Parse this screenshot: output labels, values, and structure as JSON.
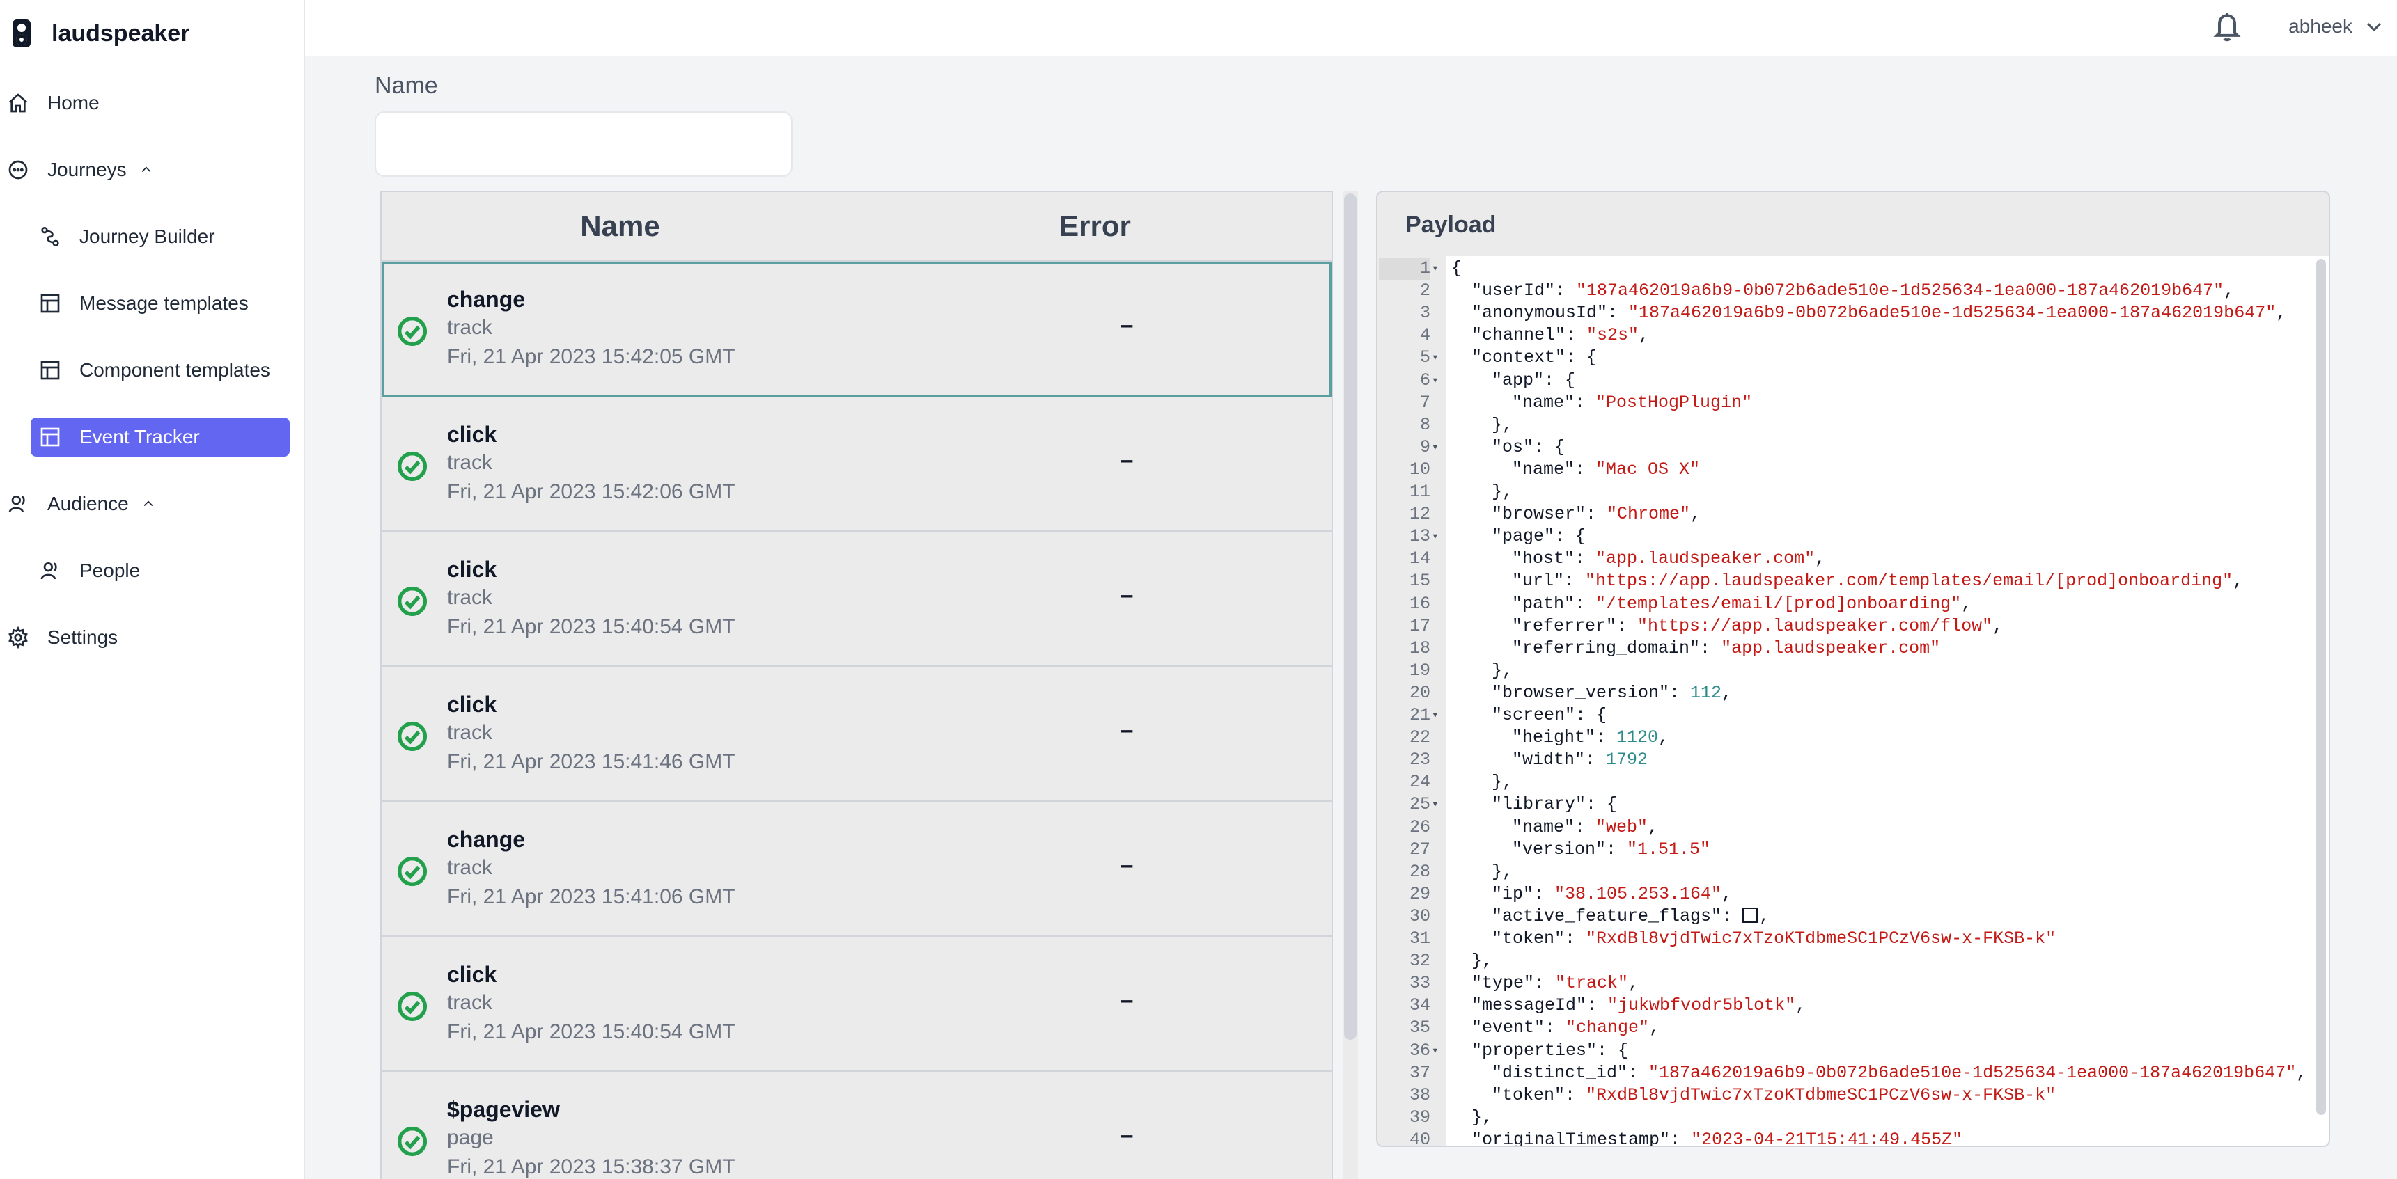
{
  "app": {
    "brand": "laudspeaker"
  },
  "sidebar": {
    "items": [
      {
        "label": "Home",
        "icon": "home-icon"
      },
      {
        "label": "Journeys",
        "icon": "journeys-icon"
      },
      {
        "label": "Journey Builder",
        "icon": "journey-builder-icon"
      },
      {
        "label": "Message templates",
        "icon": "template-icon"
      },
      {
        "label": "Component templates",
        "icon": "template-icon"
      },
      {
        "label": "Event Tracker",
        "icon": "template-icon"
      },
      {
        "label": "Audience",
        "icon": "audience-icon"
      },
      {
        "label": "People",
        "icon": "people-icon"
      },
      {
        "label": "Settings",
        "icon": "gear-icon"
      }
    ],
    "active": "Event Tracker"
  },
  "header": {
    "user": "abheek"
  },
  "filter": {
    "label": "Name",
    "value": ""
  },
  "table": {
    "headers": {
      "name": "Name",
      "error": "Error"
    },
    "rows": [
      {
        "name": "change",
        "type": "track",
        "time": "Fri, 21 Apr 2023 15:42:05 GMT",
        "error": "–"
      },
      {
        "name": "click",
        "type": "track",
        "time": "Fri, 21 Apr 2023 15:42:06 GMT",
        "error": "–"
      },
      {
        "name": "click",
        "type": "track",
        "time": "Fri, 21 Apr 2023 15:40:54 GMT",
        "error": "–"
      },
      {
        "name": "click",
        "type": "track",
        "time": "Fri, 21 Apr 2023 15:41:46 GMT",
        "error": "–"
      },
      {
        "name": "change",
        "type": "track",
        "time": "Fri, 21 Apr 2023 15:41:06 GMT",
        "error": "–"
      },
      {
        "name": "click",
        "type": "track",
        "time": "Fri, 21 Apr 2023 15:40:54 GMT",
        "error": "–"
      },
      {
        "name": "$pageview",
        "type": "page",
        "time": "Fri, 21 Apr 2023 15:38:37 GMT",
        "error": "–"
      }
    ]
  },
  "payload": {
    "title": "Payload",
    "lines": [
      {
        "n": "1",
        "fold": true,
        "indent": 0,
        "parts": [
          [
            "p",
            "{"
          ]
        ]
      },
      {
        "n": "2",
        "indent": 1,
        "parts": [
          [
            "p",
            "\"userId\": "
          ],
          [
            "s",
            "\"187a462019a6b9-0b072b6ade510e-1d525634-1ea000-187a462019b647\""
          ],
          [
            "p",
            ","
          ]
        ]
      },
      {
        "n": "3",
        "indent": 1,
        "parts": [
          [
            "p",
            "\"anonymousId\": "
          ],
          [
            "s",
            "\"187a462019a6b9-0b072b6ade510e-1d525634-1ea000-187a462019b647\""
          ],
          [
            "p",
            ","
          ]
        ]
      },
      {
        "n": "4",
        "indent": 1,
        "parts": [
          [
            "p",
            "\"channel\": "
          ],
          [
            "s",
            "\"s2s\""
          ],
          [
            "p",
            ","
          ]
        ]
      },
      {
        "n": "5",
        "fold": true,
        "indent": 1,
        "parts": [
          [
            "p",
            "\"context\": {"
          ]
        ]
      },
      {
        "n": "6",
        "fold": true,
        "indent": 2,
        "parts": [
          [
            "p",
            "\"app\": {"
          ]
        ]
      },
      {
        "n": "7",
        "indent": 3,
        "parts": [
          [
            "p",
            "\"name\": "
          ],
          [
            "s",
            "\"PostHogPlugin\""
          ]
        ]
      },
      {
        "n": "8",
        "indent": 2,
        "parts": [
          [
            "p",
            "},"
          ]
        ]
      },
      {
        "n": "9",
        "fold": true,
        "indent": 2,
        "parts": [
          [
            "p",
            "\"os\": {"
          ]
        ]
      },
      {
        "n": "10",
        "indent": 3,
        "parts": [
          [
            "p",
            "\"name\": "
          ],
          [
            "s",
            "\"Mac OS X\""
          ]
        ]
      },
      {
        "n": "11",
        "indent": 2,
        "parts": [
          [
            "p",
            "},"
          ]
        ]
      },
      {
        "n": "12",
        "indent": 2,
        "parts": [
          [
            "p",
            "\"browser\": "
          ],
          [
            "s",
            "\"Chrome\""
          ],
          [
            "p",
            ","
          ]
        ]
      },
      {
        "n": "13",
        "fold": true,
        "indent": 2,
        "parts": [
          [
            "p",
            "\"page\": {"
          ]
        ]
      },
      {
        "n": "14",
        "indent": 3,
        "parts": [
          [
            "p",
            "\"host\": "
          ],
          [
            "s",
            "\"app.laudspeaker.com\""
          ],
          [
            "p",
            ","
          ]
        ]
      },
      {
        "n": "15",
        "indent": 3,
        "parts": [
          [
            "p",
            "\"url\": "
          ],
          [
            "s",
            "\"https://app.laudspeaker.com/templates/email/[prod]onboarding\""
          ],
          [
            "p",
            ","
          ]
        ]
      },
      {
        "n": "16",
        "indent": 3,
        "parts": [
          [
            "p",
            "\"path\": "
          ],
          [
            "s",
            "\"/templates/email/[prod]onboarding\""
          ],
          [
            "p",
            ","
          ]
        ]
      },
      {
        "n": "17",
        "indent": 3,
        "parts": [
          [
            "p",
            "\"referrer\": "
          ],
          [
            "s",
            "\"https://app.laudspeaker.com/flow\""
          ],
          [
            "p",
            ","
          ]
        ]
      },
      {
        "n": "18",
        "indent": 3,
        "parts": [
          [
            "p",
            "\"referring_domain\": "
          ],
          [
            "s",
            "\"app.laudspeaker.com\""
          ]
        ]
      },
      {
        "n": "19",
        "indent": 2,
        "parts": [
          [
            "p",
            "},"
          ]
        ]
      },
      {
        "n": "20",
        "indent": 2,
        "parts": [
          [
            "p",
            "\"browser_version\": "
          ],
          [
            "n",
            "112"
          ],
          [
            "p",
            ","
          ]
        ]
      },
      {
        "n": "21",
        "fold": true,
        "indent": 2,
        "parts": [
          [
            "p",
            "\"screen\": {"
          ]
        ]
      },
      {
        "n": "22",
        "indent": 3,
        "parts": [
          [
            "p",
            "\"height\": "
          ],
          [
            "n",
            "1120"
          ],
          [
            "p",
            ","
          ]
        ]
      },
      {
        "n": "23",
        "indent": 3,
        "parts": [
          [
            "p",
            "\"width\": "
          ],
          [
            "n",
            "1792"
          ]
        ]
      },
      {
        "n": "24",
        "indent": 2,
        "parts": [
          [
            "p",
            "},"
          ]
        ]
      },
      {
        "n": "25",
        "fold": true,
        "indent": 2,
        "parts": [
          [
            "p",
            "\"library\": {"
          ]
        ]
      },
      {
        "n": "26",
        "indent": 3,
        "parts": [
          [
            "p",
            "\"name\": "
          ],
          [
            "s",
            "\"web\""
          ],
          [
            "p",
            ","
          ]
        ]
      },
      {
        "n": "27",
        "indent": 3,
        "parts": [
          [
            "p",
            "\"version\": "
          ],
          [
            "s",
            "\"1.51.5\""
          ]
        ]
      },
      {
        "n": "28",
        "indent": 2,
        "parts": [
          [
            "p",
            "},"
          ]
        ]
      },
      {
        "n": "29",
        "indent": 2,
        "parts": [
          [
            "p",
            "\"ip\": "
          ],
          [
            "s",
            "\"38.105.253.164\""
          ],
          [
            "p",
            ","
          ]
        ]
      },
      {
        "n": "30",
        "indent": 2,
        "parts": [
          [
            "p",
            "\"active_feature_flags\": "
          ],
          [
            "b",
            ""
          ],
          [
            "p",
            ","
          ]
        ]
      },
      {
        "n": "31",
        "indent": 2,
        "parts": [
          [
            "p",
            "\"token\": "
          ],
          [
            "s",
            "\"RxdBl8vjdTwic7xTzoKTdbmeSC1PCzV6sw-x-FKSB-k\""
          ]
        ]
      },
      {
        "n": "32",
        "indent": 1,
        "parts": [
          [
            "p",
            "},"
          ]
        ]
      },
      {
        "n": "33",
        "indent": 1,
        "parts": [
          [
            "p",
            "\"type\": "
          ],
          [
            "s",
            "\"track\""
          ],
          [
            "p",
            ","
          ]
        ]
      },
      {
        "n": "34",
        "indent": 1,
        "parts": [
          [
            "p",
            "\"messageId\": "
          ],
          [
            "s",
            "\"jukwbfvodr5blotk\""
          ],
          [
            "p",
            ","
          ]
        ]
      },
      {
        "n": "35",
        "indent": 1,
        "parts": [
          [
            "p",
            "\"event\": "
          ],
          [
            "s",
            "\"change\""
          ],
          [
            "p",
            ","
          ]
        ]
      },
      {
        "n": "36",
        "fold": true,
        "indent": 1,
        "parts": [
          [
            "p",
            "\"properties\": {"
          ]
        ]
      },
      {
        "n": "37",
        "indent": 2,
        "parts": [
          [
            "p",
            "\"distinct_id\": "
          ],
          [
            "s",
            "\"187a462019a6b9-0b072b6ade510e-1d525634-1ea000-187a462019b647\""
          ],
          [
            "p",
            ","
          ]
        ]
      },
      {
        "n": "38",
        "indent": 2,
        "parts": [
          [
            "p",
            "\"token\": "
          ],
          [
            "s",
            "\"RxdBl8vjdTwic7xTzoKTdbmeSC1PCzV6sw-x-FKSB-k\""
          ]
        ]
      },
      {
        "n": "39",
        "indent": 1,
        "parts": [
          [
            "p",
            "},"
          ]
        ]
      },
      {
        "n": "40",
        "indent": 1,
        "parts": [
          [
            "p",
            "\"originalTimestamp\": "
          ],
          [
            "s",
            "\"2023-04-21T15:41:49.455Z\""
          ]
        ]
      }
    ]
  }
}
